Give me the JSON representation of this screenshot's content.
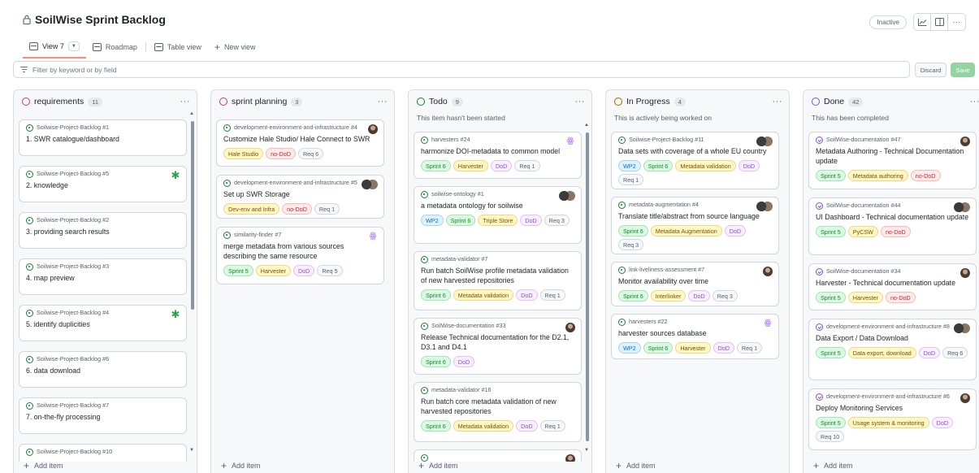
{
  "project": {
    "title": "SoilWise Sprint Backlog",
    "status": "Inactive"
  },
  "tabs": [
    {
      "label": "View 7",
      "active": true
    },
    {
      "label": "Roadmap"
    },
    {
      "label": "Table view"
    }
  ],
  "new_view_label": "New view",
  "filter": {
    "placeholder": "Filter by keyword or by field",
    "discard": "Discard",
    "save": "Save"
  },
  "add_item_label": "Add item",
  "label_colors": {
    "green": {
      "bg": "#dafbe1",
      "fg": "#1a7f37",
      "border": "#a6e3b5"
    },
    "yellow": {
      "bg": "#fff8c5",
      "fg": "#7d4e00",
      "border": "#eed888"
    },
    "red": {
      "bg": "#ffebe9",
      "fg": "#cf222e",
      "border": "#ffb8b3"
    },
    "purple": {
      "bg": "#fbefff",
      "fg": "#8250df",
      "border": "#dcc2ff"
    },
    "blue": {
      "bg": "#ddf4ff",
      "fg": "#0969da",
      "border": "#a5d2ff"
    },
    "gray": {
      "bg": "#f6f8fa",
      "fg": "#57606a",
      "border": "#d0d7de"
    }
  },
  "columns": [
    {
      "name": "requirements",
      "count": "11",
      "color": "#bf3989",
      "description": "",
      "cards": [
        {
          "repo": "Soilwise-Project-Backlog #1",
          "title": "1. SWR catalogue/dashboard",
          "labels": []
        },
        {
          "repo": "Soilwise-Project-Backlog #5",
          "title": "2. knowledge",
          "labels": [],
          "avatar": "icon-green"
        },
        {
          "repo": "Soilwise-Project-Backlog #2",
          "title": "3. providing search results",
          "labels": []
        },
        {
          "repo": "Soilwise-Project-Backlog #3",
          "title": "4. map preview",
          "labels": []
        },
        {
          "repo": "Soilwise-Project-Backlog #4",
          "title": "5. identify duplicities",
          "labels": [],
          "avatar": "icon-green"
        },
        {
          "repo": "Soilwise-Project-Backlog #6",
          "title": "6. data download",
          "labels": []
        },
        {
          "repo": "Soilwise-Project-Backlog #7",
          "title": "7. on-the-fly processing",
          "labels": []
        },
        {
          "repo": "Soilwise-Project-Backlog #10",
          "title": "",
          "labels": []
        }
      ]
    },
    {
      "name": "sprint planning",
      "count": "3",
      "color": "#bf3989",
      "description": "",
      "cards": [
        {
          "repo": "development-environment-and-infrastructure #4",
          "title": "Customize Hale Studio/ Hale Connect to SWR",
          "labels": [
            {
              "text": "Hale Studio",
              "color": "yellow"
            },
            {
              "text": "no-DoD",
              "color": "red"
            },
            {
              "text": "Req 6",
              "color": "gray"
            }
          ],
          "avatar": "person"
        },
        {
          "repo": "development-environment-and-infrastructure #5",
          "title": "Set up SWR Storage",
          "labels": [
            {
              "text": "Dev-env and Infra",
              "color": "yellow"
            },
            {
              "text": "no-DoD",
              "color": "red"
            },
            {
              "text": "Req 1",
              "color": "gray"
            }
          ],
          "avatar": "double"
        },
        {
          "repo": "similarity-finder #7",
          "title": "merge metadata from various sources describing the same resource",
          "labels": [
            {
              "text": "Sprint 5",
              "color": "green"
            },
            {
              "text": "Harvester",
              "color": "yellow"
            },
            {
              "text": "DoD",
              "color": "purple"
            },
            {
              "text": "Req 5",
              "color": "gray"
            }
          ],
          "avatar": "icon-purple"
        }
      ]
    },
    {
      "name": "Todo",
      "count": "9",
      "color": "#1a7f37",
      "description": "This item hasn't been started",
      "cards": [
        {
          "repo": "harvesters #24",
          "title": "harmonize DOI-metadata to common model",
          "labels": [
            {
              "text": "Sprint 6",
              "color": "green"
            },
            {
              "text": "Harvester",
              "color": "yellow"
            },
            {
              "text": "DoD",
              "color": "purple"
            },
            {
              "text": "Req 1",
              "color": "gray"
            }
          ],
          "avatar": "icon-purple"
        },
        {
          "repo": "soilwise-ontology #1",
          "title": "a metadata ontology for soilwise",
          "labels": [
            {
              "text": "WP2",
              "color": "blue"
            },
            {
              "text": "Sprint 6",
              "color": "green"
            },
            {
              "text": "Triple Store",
              "color": "yellow"
            },
            {
              "text": "DoD",
              "color": "purple"
            },
            {
              "text": "Req 3",
              "color": "gray"
            }
          ],
          "avatar": "double"
        },
        {
          "repo": "metadata-validator #7",
          "title": "Run batch SoilWise profile metadata validation of new harvested repositories",
          "labels": [
            {
              "text": "Sprint 6",
              "color": "green"
            },
            {
              "text": "Metadata validation",
              "color": "yellow"
            },
            {
              "text": "DoD",
              "color": "purple"
            },
            {
              "text": "Req 1",
              "color": "gray"
            }
          ]
        },
        {
          "repo": "SoilWise-documentation #33",
          "title": "Release Technical documentation for the D2.1, D3.1 and D4.1",
          "labels": [
            {
              "text": "Sprint 6",
              "color": "green"
            },
            {
              "text": "DoD",
              "color": "purple"
            }
          ],
          "avatar": "person"
        },
        {
          "repo": "metadata-validator #16",
          "title": "Run batch core metadata validation of new harvested repositories",
          "labels": [
            {
              "text": "Sprint 6",
              "color": "green"
            },
            {
              "text": "Metadata validation",
              "color": "yellow"
            },
            {
              "text": "DoD",
              "color": "purple"
            },
            {
              "text": "Req 1",
              "color": "gray"
            }
          ]
        },
        {
          "repo": "",
          "title": "",
          "labels": [],
          "avatar": "person"
        }
      ]
    },
    {
      "name": "In Progress",
      "count": "4",
      "color": "#9a6700",
      "description": "This is actively being worked on",
      "cards": [
        {
          "repo": "Soilwise-Project-Backlog #11",
          "title": "Data sets with coverage of a whole EU country",
          "labels": [
            {
              "text": "WP2",
              "color": "blue"
            },
            {
              "text": "Sprint 6",
              "color": "green"
            },
            {
              "text": "Metadata validation",
              "color": "yellow"
            },
            {
              "text": "DoD",
              "color": "purple"
            },
            {
              "text": "Req 1",
              "color": "gray"
            }
          ],
          "avatar": "double"
        },
        {
          "repo": "metadata-augmentation #4",
          "title": "Translate title/abstract from source language",
          "labels": [
            {
              "text": "Sprint 6",
              "color": "green"
            },
            {
              "text": "Metadata Augmentation",
              "color": "yellow"
            },
            {
              "text": "DoD",
              "color": "purple"
            },
            {
              "text": "Req 3",
              "color": "gray"
            }
          ],
          "avatar": "double"
        },
        {
          "repo": "link-liveliness-assessment #7",
          "title": "Monitor availability over time",
          "labels": [
            {
              "text": "Sprint 6",
              "color": "green"
            },
            {
              "text": "Interlinker",
              "color": "yellow"
            },
            {
              "text": "DoD",
              "color": "purple"
            },
            {
              "text": "Req 3",
              "color": "gray"
            }
          ],
          "avatar": "person"
        },
        {
          "repo": "harvesters #22",
          "title": "harvester sources database",
          "labels": [
            {
              "text": "WP2",
              "color": "blue"
            },
            {
              "text": "Sprint 6",
              "color": "green"
            },
            {
              "text": "Harvester",
              "color": "yellow"
            },
            {
              "text": "DoD",
              "color": "purple"
            },
            {
              "text": "Req 1",
              "color": "gray"
            }
          ],
          "avatar": "icon-purple"
        }
      ]
    },
    {
      "name": "Done",
      "count": "42",
      "color": "#8250df",
      "description": "This has been completed",
      "cards": [
        {
          "repo": "SoilWise-documentation #47",
          "title": "Metadata Authoring - Technical Documentation update",
          "labels": [
            {
              "text": "Sprint 5",
              "color": "green"
            },
            {
              "text": "Metadata authoring",
              "color": "yellow"
            },
            {
              "text": "no-DoD",
              "color": "red"
            }
          ],
          "avatar": "person"
        },
        {
          "repo": "SoilWise-documentation #44",
          "title": "UI Dashboard - Technical documentation update",
          "labels": [
            {
              "text": "Sprint 5",
              "color": "green"
            },
            {
              "text": "PyCSW",
              "color": "yellow"
            },
            {
              "text": "no-DoD",
              "color": "red"
            }
          ],
          "avatar": "double"
        },
        {
          "repo": "SoilWise-documentation #34",
          "title": "Harvester - Technical documentation update",
          "labels": [
            {
              "text": "Sprint 5",
              "color": "green"
            },
            {
              "text": "Harvester",
              "color": "yellow"
            },
            {
              "text": "no-DoD",
              "color": "red"
            }
          ],
          "avatar": "person"
        },
        {
          "repo": "development-environment-and-infrastructure #8",
          "title": "Data Export / Data Download",
          "labels": [
            {
              "text": "Sprint 5",
              "color": "green"
            },
            {
              "text": "Data export, download",
              "color": "yellow"
            },
            {
              "text": "DoD",
              "color": "purple"
            },
            {
              "text": "Req 6",
              "color": "gray"
            }
          ],
          "avatar": "double"
        },
        {
          "repo": "development-environment-and-infrastructure #6",
          "title": "Deploy Monitoring Services",
          "labels": [
            {
              "text": "Sprint 5",
              "color": "green"
            },
            {
              "text": "Usage system & monitoring",
              "color": "yellow"
            },
            {
              "text": "DoD",
              "color": "purple"
            },
            {
              "text": "Req 10",
              "color": "gray"
            }
          ],
          "avatar": "person"
        }
      ]
    }
  ]
}
